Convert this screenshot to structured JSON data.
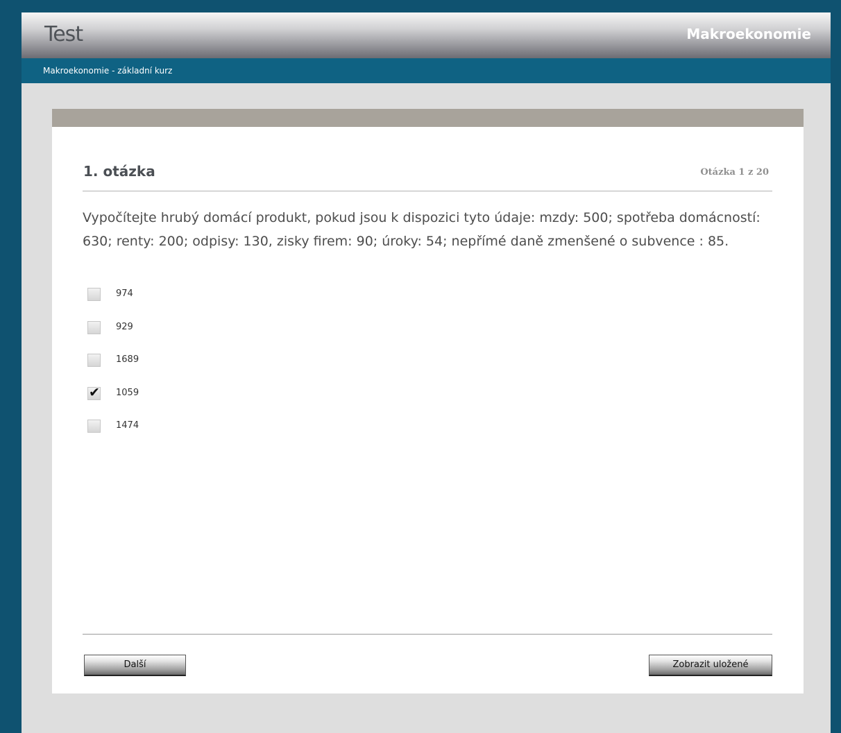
{
  "header": {
    "app_title": "Test",
    "course_name": "Makroekonomie"
  },
  "breadcrumb": "Makroekonomie - základní kurz",
  "question": {
    "title": "1. otázka",
    "counter": "Otázka 1 z 20",
    "text": "Vypočítejte hrubý domácí produkt, pokud jsou k dispozici tyto údaje: mzdy: 500; spotřeba domácností: 630; renty: 200; odpisy: 130, zisky firem: 90; úroky: 54; nepřímé daně zmenšené o subvence :  85."
  },
  "answers": [
    {
      "label": "974",
      "checked": false
    },
    {
      "label": "929",
      "checked": false
    },
    {
      "label": "1689",
      "checked": false
    },
    {
      "label": "1059",
      "checked": true
    },
    {
      "label": "1474",
      "checked": false
    }
  ],
  "buttons": {
    "next": "Další",
    "show_saved": "Zobrazit uložené"
  },
  "colors": {
    "background": "#0f5270",
    "subbar": "#0f6283",
    "panel_top": "#a8a39b"
  }
}
